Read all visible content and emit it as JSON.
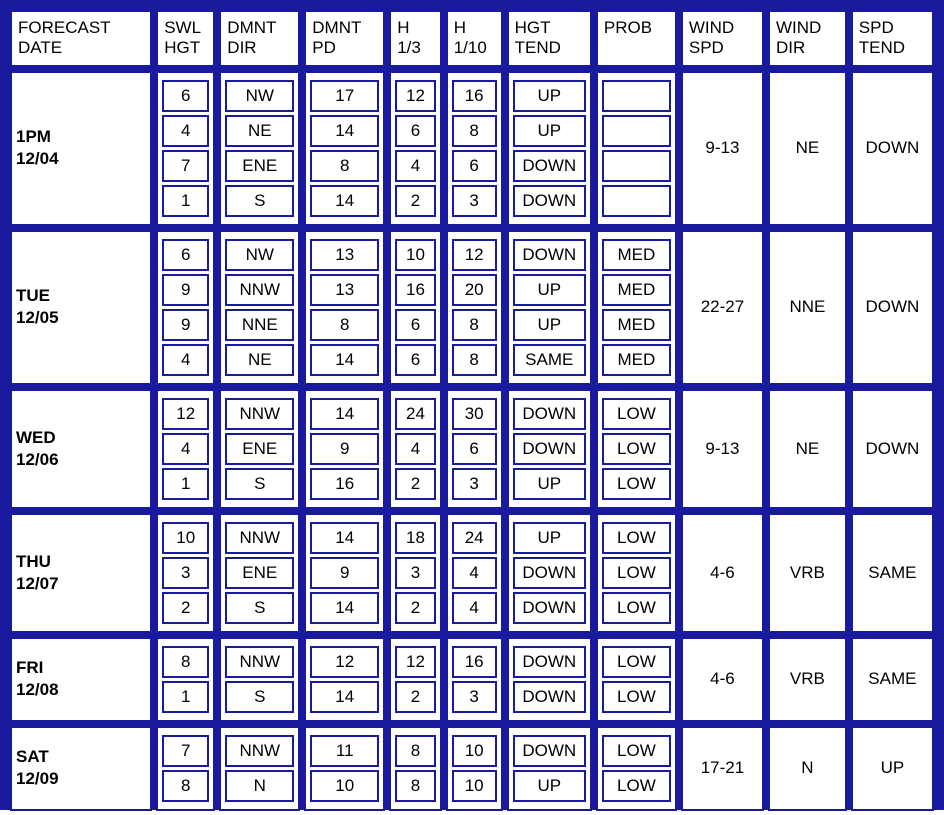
{
  "headers": {
    "date": "FORECAST\nDATE",
    "swl": "SWL\nHGT",
    "ddir": "DMNT\nDIR",
    "dpd": "DMNT\nPD",
    "h13": "H\n1/3",
    "h110": "H\n1/10",
    "htend": "HGT\nTEND",
    "prob": "PROB",
    "wspd": "WIND\nSPD",
    "wdir": "WIND\nDIR",
    "stend": "SPD\nTEND"
  },
  "rows": [
    {
      "date": "1PM\n12/04",
      "swells": [
        {
          "hgt": "6",
          "dir": "NW",
          "pd": "17",
          "h13": "12",
          "h110": "16",
          "tend": "UP",
          "prob": ""
        },
        {
          "hgt": "4",
          "dir": "NE",
          "pd": "14",
          "h13": "6",
          "h110": "8",
          "tend": "UP",
          "prob": ""
        },
        {
          "hgt": "7",
          "dir": "ENE",
          "pd": "8",
          "h13": "4",
          "h110": "6",
          "tend": "DOWN",
          "prob": ""
        },
        {
          "hgt": "1",
          "dir": "S",
          "pd": "14",
          "h13": "2",
          "h110": "3",
          "tend": "DOWN",
          "prob": ""
        }
      ],
      "wspd": "9-13",
      "wdir": "NE",
      "stend": "DOWN"
    },
    {
      "date": "TUE\n12/05",
      "swells": [
        {
          "hgt": "6",
          "dir": "NW",
          "pd": "13",
          "h13": "10",
          "h110": "12",
          "tend": "DOWN",
          "prob": "MED"
        },
        {
          "hgt": "9",
          "dir": "NNW",
          "pd": "13",
          "h13": "16",
          "h110": "20",
          "tend": "UP",
          "prob": "MED"
        },
        {
          "hgt": "9",
          "dir": "NNE",
          "pd": "8",
          "h13": "6",
          "h110": "8",
          "tend": "UP",
          "prob": "MED"
        },
        {
          "hgt": "4",
          "dir": "NE",
          "pd": "14",
          "h13": "6",
          "h110": "8",
          "tend": "SAME",
          "prob": "MED"
        }
      ],
      "wspd": "22-27",
      "wdir": "NNE",
      "stend": "DOWN"
    },
    {
      "date": "WED\n12/06",
      "swells": [
        {
          "hgt": "12",
          "dir": "NNW",
          "pd": "14",
          "h13": "24",
          "h110": "30",
          "tend": "DOWN",
          "prob": "LOW"
        },
        {
          "hgt": "4",
          "dir": "ENE",
          "pd": "9",
          "h13": "4",
          "h110": "6",
          "tend": "DOWN",
          "prob": "LOW"
        },
        {
          "hgt": "1",
          "dir": "S",
          "pd": "16",
          "h13": "2",
          "h110": "3",
          "tend": "UP",
          "prob": "LOW"
        }
      ],
      "wspd": "9-13",
      "wdir": "NE",
      "stend": "DOWN"
    },
    {
      "date": "THU\n12/07",
      "swells": [
        {
          "hgt": "10",
          "dir": "NNW",
          "pd": "14",
          "h13": "18",
          "h110": "24",
          "tend": "UP",
          "prob": "LOW"
        },
        {
          "hgt": "3",
          "dir": "ENE",
          "pd": "9",
          "h13": "3",
          "h110": "4",
          "tend": "DOWN",
          "prob": "LOW"
        },
        {
          "hgt": "2",
          "dir": "S",
          "pd": "14",
          "h13": "2",
          "h110": "4",
          "tend": "DOWN",
          "prob": "LOW"
        }
      ],
      "wspd": "4-6",
      "wdir": "VRB",
      "stend": "SAME"
    },
    {
      "date": "FRI\n12/08",
      "swells": [
        {
          "hgt": "8",
          "dir": "NNW",
          "pd": "12",
          "h13": "12",
          "h110": "16",
          "tend": "DOWN",
          "prob": "LOW"
        },
        {
          "hgt": "1",
          "dir": "S",
          "pd": "14",
          "h13": "2",
          "h110": "3",
          "tend": "DOWN",
          "prob": "LOW"
        }
      ],
      "wspd": "4-6",
      "wdir": "VRB",
      "stend": "SAME"
    },
    {
      "date": "SAT\n12/09",
      "swells": [
        {
          "hgt": "7",
          "dir": "NNW",
          "pd": "11",
          "h13": "8",
          "h110": "10",
          "tend": "DOWN",
          "prob": "LOW"
        },
        {
          "hgt": "8",
          "dir": "N",
          "pd": "10",
          "h13": "8",
          "h110": "10",
          "tend": "UP",
          "prob": "LOW"
        }
      ],
      "wspd": "17-21",
      "wdir": "N",
      "stend": "UP"
    }
  ]
}
